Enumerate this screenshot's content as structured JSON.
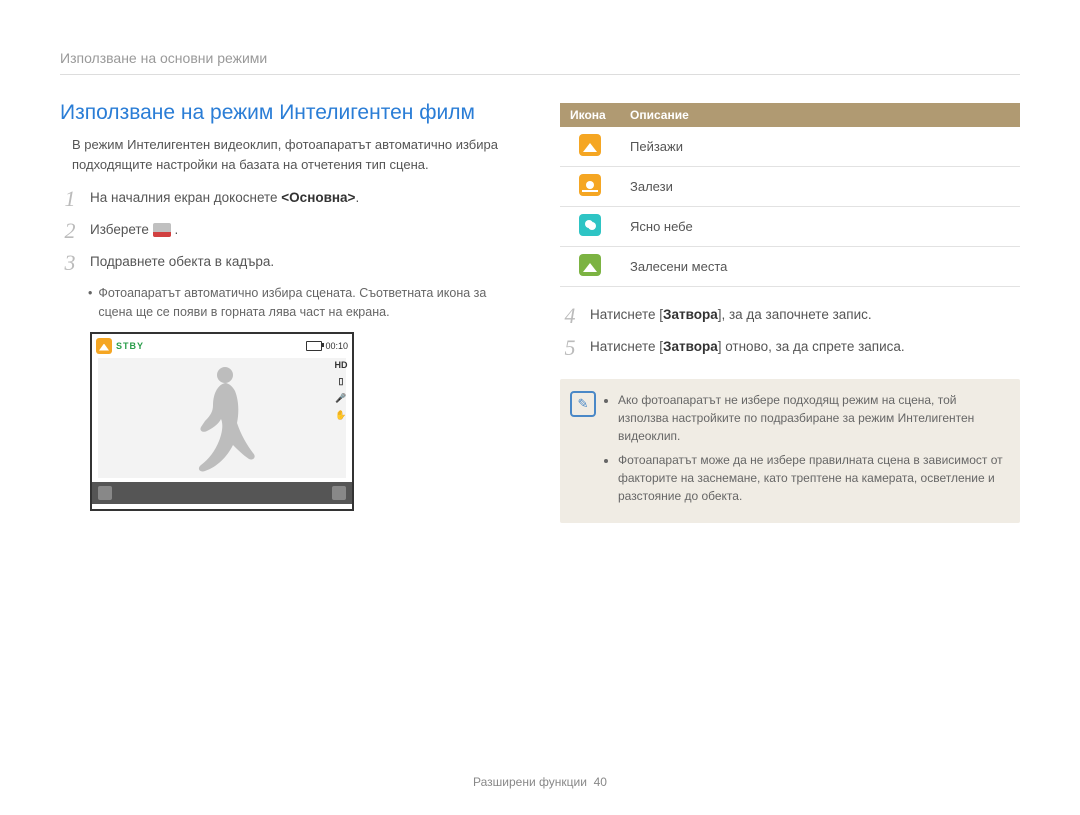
{
  "breadcrumb": "Използване на основни режими",
  "heading": "Използване на режим Интелигентен филм",
  "intro": "В режим Интелигентен видеоклип, фотоапаратът автоматично избира подходящите настройки на базата на отчетения тип сцена.",
  "steps_left": [
    {
      "num": "1",
      "pre": "На началния екран докоснете ",
      "bold": "<Основна>",
      "post": "."
    },
    {
      "num": "2",
      "pre": "Изберете ",
      "bold": "",
      "post": " ."
    },
    {
      "num": "3",
      "pre": "Подравнете обекта в кадъра.",
      "bold": "",
      "post": ""
    }
  ],
  "step3_bullet": "Фотоапаратът автоматично избира сцената. Съответната икона за сцена ще се появи в горната лява част на екрана.",
  "display": {
    "stby": "STBY",
    "timer": "00:10",
    "hd": "HD"
  },
  "table": {
    "h_icon": "Икона",
    "h_desc": "Описание",
    "rows": [
      {
        "cls": "ic-landscape",
        "label": "Пейзажи"
      },
      {
        "cls": "ic-sunset",
        "label": "Залези"
      },
      {
        "cls": "ic-sky",
        "label": "Ясно небе"
      },
      {
        "cls": "ic-forest",
        "label": "Залесени места"
      }
    ]
  },
  "steps_right": [
    {
      "num": "4",
      "pre": "Натиснете [",
      "bold": "Затвора",
      "post": "], за да започнете запис."
    },
    {
      "num": "5",
      "pre": "Натиснете [",
      "bold": "Затвора",
      "post": "] отново, за да спрете записа."
    }
  ],
  "note": {
    "items": [
      "Ако фотоапаратът не избере подходящ режим на сцена, той използва настройките по подразбиране за режим Интелигентен видеоклип.",
      "Фотоапаратът може да не избере правилната сцена в зависимост от факторите на заснемане, като трептене на камерата, осветление и разстояние до обекта."
    ]
  },
  "footer": {
    "text": "Разширени функции",
    "page": "40"
  }
}
